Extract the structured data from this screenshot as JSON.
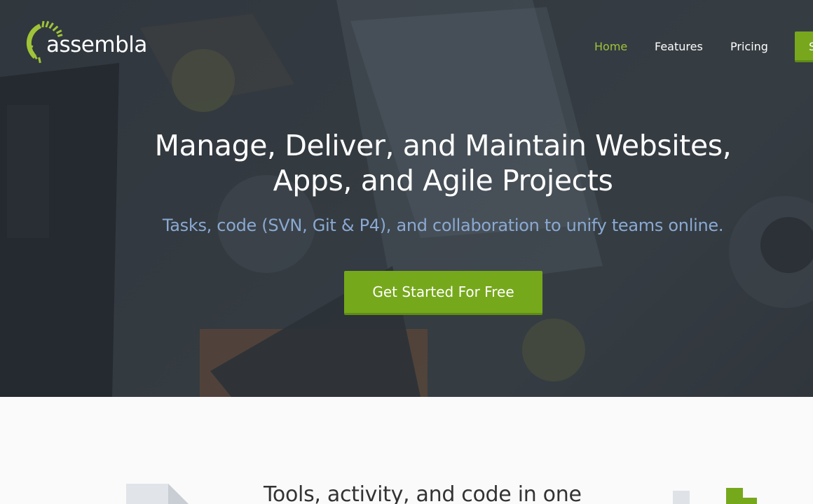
{
  "brand": {
    "name": "assembla",
    "logo_icon": "sunburst-logo-icon",
    "accent": "#78a71e"
  },
  "nav": {
    "items": [
      {
        "label": "Home",
        "active": true
      },
      {
        "label": "Features",
        "active": false
      },
      {
        "label": "Pricing",
        "active": false
      }
    ],
    "signup_label": "S"
  },
  "hero": {
    "headline_line1": "Manage, Deliver, and Maintain Websites,",
    "headline_line2": "Apps, and Agile Projects",
    "subheadline": "Tasks, code (SVN, Git & P4), and collaboration to unify teams online.",
    "cta_label": "Get Started For Free"
  },
  "section2": {
    "title": "Tools, activity, and code in one"
  }
}
